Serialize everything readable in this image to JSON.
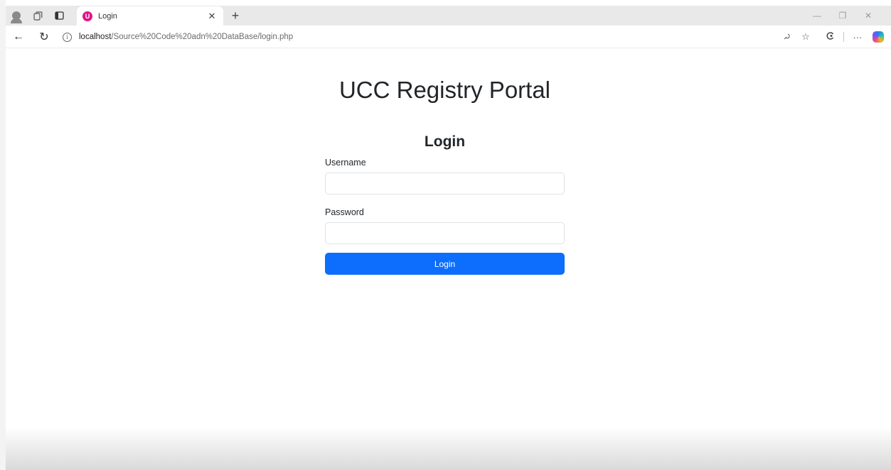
{
  "browser": {
    "tab_title": "Login",
    "url_host": "localhost",
    "url_path": "/Source%20Code%20adn%20DataBase/login.php"
  },
  "page": {
    "portal_title": "UCC Registry Portal",
    "login_heading": "Login",
    "username_label": "Username",
    "username_value": "",
    "password_label": "Password",
    "password_value": "",
    "login_button_label": "Login"
  },
  "colors": {
    "primary_button": "#0d6efd",
    "tab_favicon": "#e0148a"
  },
  "icons": {
    "profile": "profile-icon",
    "workspaces": "workspaces-icon",
    "tab_actions": "tab-actions-icon",
    "back": "back-arrow-icon",
    "refresh": "refresh-icon",
    "info": "info-icon",
    "read_aloud": "read-aloud-icon",
    "favorite": "star-icon",
    "extensions": "extensions-icon",
    "more": "more-icon",
    "copilot": "copilot-icon"
  }
}
